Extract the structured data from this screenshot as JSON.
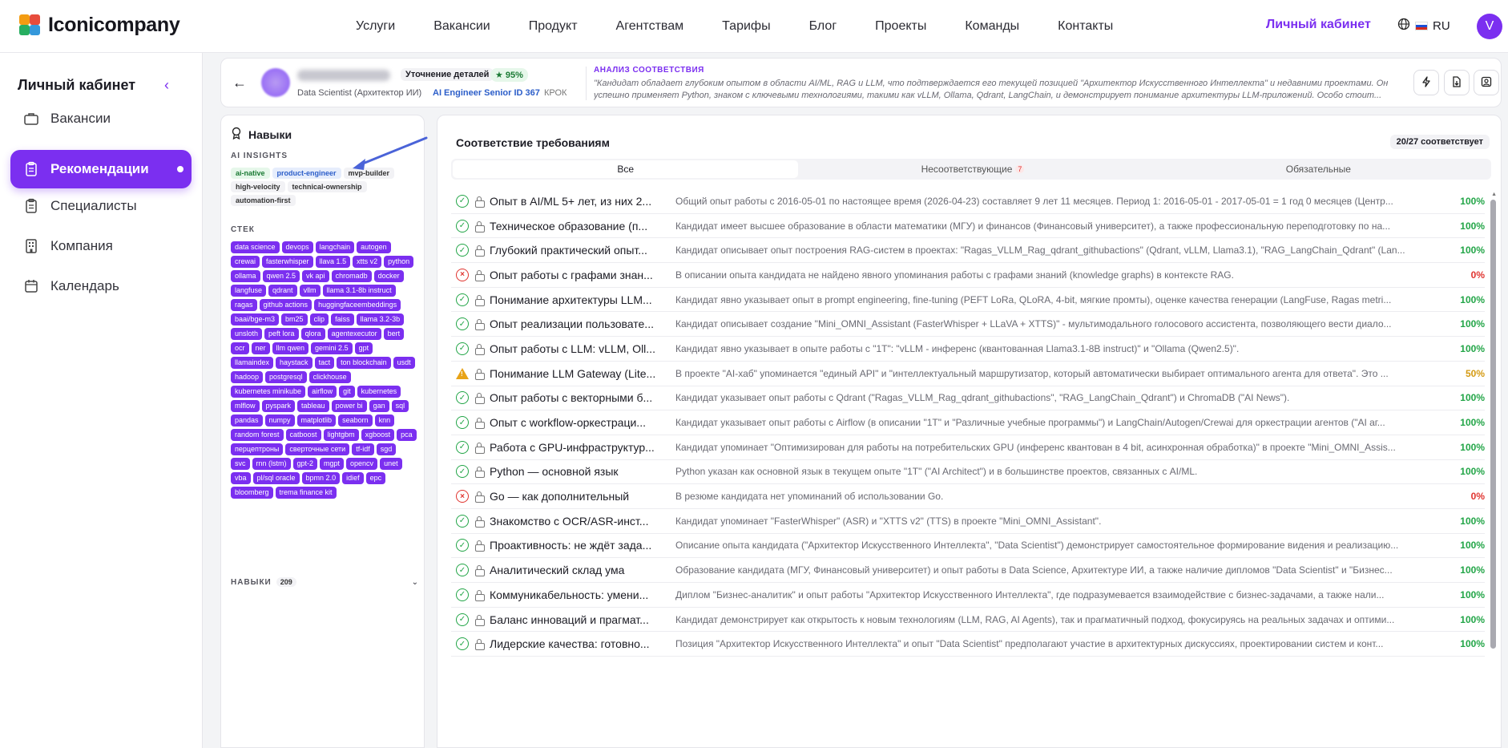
{
  "brand": {
    "name": "Iconicompany"
  },
  "nav": [
    "Услуги",
    "Вакансии",
    "Продукт",
    "Агентствам",
    "Тарифы",
    "Блог",
    "Проекты",
    "Команды",
    "Контакты"
  ],
  "topbar": {
    "cabinet": "Личный кабинет",
    "lang": "RU",
    "avatar": "V"
  },
  "sidebar": {
    "title": "Личный кабинет",
    "items": [
      {
        "label": "Вакансии",
        "icon": "briefcase-icon"
      },
      {
        "label": "Рекомендации",
        "icon": "clipboard-icon",
        "active": true
      },
      {
        "label": "Специалисты",
        "icon": "clipboard-list-icon"
      },
      {
        "label": "Компания",
        "icon": "building-icon"
      },
      {
        "label": "Календарь",
        "icon": "calendar-icon"
      }
    ]
  },
  "candidate": {
    "detail_pill": "Уточнение деталей",
    "score": "95%",
    "role": "Data Scientist (Архитектор ИИ)",
    "vacancy": "AI Engineer Senior ID 367",
    "code": "КРОК"
  },
  "analysis": {
    "title": "АНАЛИЗ СООТВЕТСТВИЯ",
    "text": "\"Кандидат обладает глубоким опытом в области AI/ML, RAG и LLM, что подтверждается его текущей позицией \"Архитектор Искусственного Интеллекта\" и недавними проектами. Он успешно применяет Python, знаком с ключевыми технологиями, такими как vLLM, Ollama, Qdrant, LangChain, и демонстрирует понимание архитектуры LLM-приложений. Особо стоит..."
  },
  "skills_panel": {
    "title": "Навыки",
    "insights_label": "AI INSIGHTS",
    "insights": [
      {
        "label": "ai-native",
        "tone": "green"
      },
      {
        "label": "product-engineer",
        "tone": "blue"
      },
      {
        "label": "mvp-builder",
        "tone": "gray"
      },
      {
        "label": "high-velocity",
        "tone": "gray"
      },
      {
        "label": "technical-ownership",
        "tone": "gray"
      },
      {
        "label": "automation-first",
        "tone": "gray"
      }
    ],
    "stack_label": "СТЕК",
    "stack": [
      "data science",
      "devops",
      "langchain",
      "autogen",
      "crewai",
      "fasterwhisper",
      "llava 1.5",
      "xtts v2",
      "python",
      "ollama",
      "qwen 2.5",
      "vk api",
      "chromadb",
      "docker",
      "langfuse",
      "qdrant",
      "vllm",
      "llama 3.1-8b instruct",
      "ragas",
      "github actions",
      "huggingfaceembeddings",
      "baai/bge-m3",
      "bm25",
      "clip",
      "faiss",
      "llama 3.2-3b",
      "unsloth",
      "peft lora",
      "qlora",
      "agentexecutor",
      "bert",
      "ocr",
      "ner",
      "llm qwen",
      "gemini 2.5",
      "gpt",
      "llamaindex",
      "haystack",
      "tact",
      "ton blockchain",
      "usdt",
      "hadoop",
      "postgresql",
      "clickhouse",
      "kubernetes minikube",
      "airflow",
      "git",
      "kubernetes",
      "mlflow",
      "pyspark",
      "tableau",
      "power bi",
      "gan",
      "sql",
      "pandas",
      "numpy",
      "matplotlib",
      "seaborn",
      "knn",
      "random forest",
      "catboost",
      "lightgbm",
      "xgboost",
      "pca",
      "перцептроны",
      "сверточные сети",
      "tf-idf",
      "sgd",
      "svc",
      "rnn (lstm)",
      "gpt-2",
      "mgpt",
      "opencv",
      "unet",
      "vba",
      "pl/sql oracle",
      "bpmn 2.0",
      "idief",
      "epc",
      "bloomberg",
      "trema finance kit"
    ],
    "skills_label": "НАВЫКИ",
    "skills_count": "209"
  },
  "requirements": {
    "title": "Соответствие требованиям",
    "summary": "20/27 соответствует",
    "tabs": [
      {
        "label": "Все",
        "active": true
      },
      {
        "label": "Несоответствующие",
        "badge": "7"
      },
      {
        "label": "Обязательные"
      }
    ],
    "rows": [
      {
        "status": "ok",
        "title": "Опыт в AI/ML 5+ лет, из них 2...",
        "desc": "Общий опыт работы с 2016-05-01 по настоящее время (2026-04-23) составляет 9 лет 11 месяцев. Период 1: 2016-05-01 - 2017-05-01 = 1 год 0 месяцев (Центр...",
        "pct": "100%"
      },
      {
        "status": "ok",
        "title": "Техническое образование (п...",
        "desc": "Кандидат имеет высшее образование в области математики (МГУ) и финансов (Финансовый университет), а также профессиональную переподготовку по на...",
        "pct": "100%"
      },
      {
        "status": "ok",
        "title": "Глубокий практический опыт...",
        "desc": "Кандидат описывает опыт построения RAG-систем в проектах: \"Ragas_VLLM_Rag_qdrant_githubactions\" (Qdrant, vLLM, Llama3.1), \"RAG_LangChain_Qdrant\" (Lan...",
        "pct": "100%"
      },
      {
        "status": "fail",
        "title": "Опыт работы с графами знан...",
        "desc": "В описании опыта кандидата не найдено явного упоминания работы с графами знаний (knowledge graphs) в контексте RAG.",
        "pct": "0%"
      },
      {
        "status": "ok",
        "title": "Понимание архитектуры LLM...",
        "desc": "Кандидат явно указывает опыт в prompt engineering, fine-tuning (PEFT LoRa, QLoRA, 4-bit, мягкие промты), оценке качества генерации (LangFuse, Ragas metri...",
        "pct": "100%"
      },
      {
        "status": "ok",
        "title": "Опыт реализации пользовате...",
        "desc": "Кандидат описывает создание \"Mini_OMNI_Assistant (FasterWhisper + LLaVA + XTTS)\" - мультимодального голосового ассистента, позволяющего вести диало...",
        "pct": "100%"
      },
      {
        "status": "ok",
        "title": "Опыт работы с LLM: vLLM, Oll...",
        "desc": "Кандидат явно указывает в опыте работы с \"1T\": \"vLLM - инференс (квантованная Llama3.1-8B instruct)\" и \"Ollama (Qwen2.5)\".",
        "pct": "100%"
      },
      {
        "status": "warn",
        "title": "Понимание LLM Gateway (Lite...",
        "desc": "В проекте \"AI-хаб\" упоминается \"единый API\" и \"интеллектуальный маршрутизатор, который автоматически выбирает оптимального агента для ответа\". Это ...",
        "pct": "50%"
      },
      {
        "status": "ok",
        "title": "Опыт работы с векторными б...",
        "desc": "Кандидат указывает опыт работы с Qdrant (\"Ragas_VLLM_Rag_qdrant_githubactions\", \"RAG_LangChain_Qdrant\") и ChromaDB (\"AI News\").",
        "pct": "100%"
      },
      {
        "status": "ok",
        "title": "Опыт с workflow-оркестраци...",
        "desc": "Кандидат указывает опыт работы с Airflow (в описании \"1T\" и \"Различные учебные программы\") и LangChain/Autogen/Crewai для оркестрации агентов (\"AI аг...",
        "pct": "100%"
      },
      {
        "status": "ok",
        "title": "Работа с GPU-инфраструктур...",
        "desc": "Кандидат упоминает \"Оптимизирован для работы на потребительских GPU (инференс квантован в 4 bit, асинхронная обработка)\" в проекте \"Mini_OMNI_Assis...",
        "pct": "100%"
      },
      {
        "status": "ok",
        "title": "Python — основной язык",
        "desc": "Python указан как основной язык в текущем опыте \"1T\" (\"AI Architect\") и в большинстве проектов, связанных с AI/ML.",
        "pct": "100%"
      },
      {
        "status": "fail",
        "title": "Go — как дополнительный",
        "desc": "В резюме кандидата нет упоминаний об использовании Go.",
        "pct": "0%"
      },
      {
        "status": "ok",
        "title": "Знакомство с OCR/ASR-инст...",
        "desc": "Кандидат упоминает \"FasterWhisper\" (ASR) и \"XTTS v2\" (TTS) в проекте \"Mini_OMNI_Assistant\".",
        "pct": "100%"
      },
      {
        "status": "ok",
        "title": "Проактивность: не ждёт зада...",
        "desc": "Описание опыта кандидата (\"Архитектор Искусственного Интеллекта\", \"Data Scientist\") демонстрирует самостоятельное формирование видения и реализацию...",
        "pct": "100%"
      },
      {
        "status": "ok",
        "title": "Аналитический склад ума",
        "desc": "Образование кандидата (МГУ, Финансовый университет) и опыт работы в Data Science, Архитектуре ИИ, а также наличие дипломов \"Data Scientist\" и \"Бизнес...",
        "pct": "100%"
      },
      {
        "status": "ok",
        "title": "Коммуникабельность: умени...",
        "desc": "Диплом \"Бизнес-аналитик\" и опыт работы \"Архитектор Искусственного Интеллекта\", где подразумевается взаимодействие с бизнес-задачами, а также нали...",
        "pct": "100%"
      },
      {
        "status": "ok",
        "title": "Баланс инноваций и прагмат...",
        "desc": "Кандидат демонстрирует как открытость к новым технологиям (LLM, RAG, AI Agents), так и прагматичный подход, фокусируясь на реальных задачах и оптими...",
        "pct": "100%"
      },
      {
        "status": "ok",
        "title": "Лидерские качества: готовно...",
        "desc": "Позиция \"Архитектор Искусственного Интеллекта\" и опыт \"Data Scientist\" предполагают участие в архитектурных дискуссиях, проектировании систем и конт...",
        "pct": "100%"
      }
    ]
  }
}
